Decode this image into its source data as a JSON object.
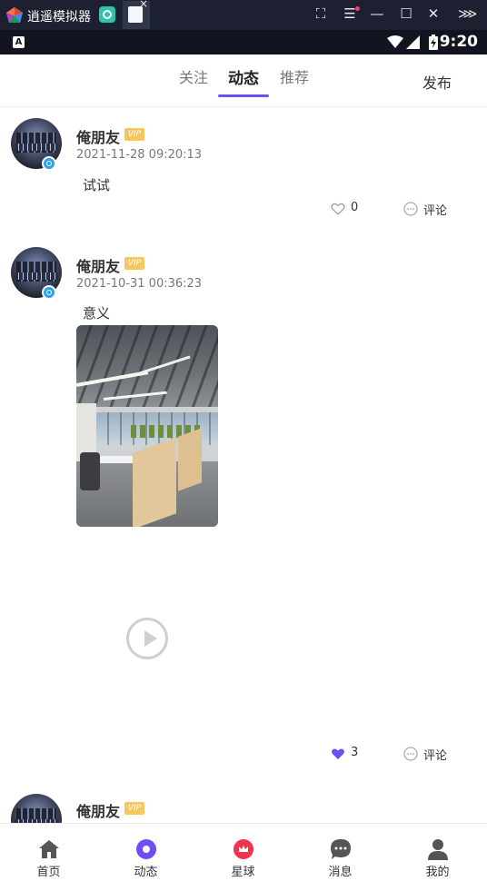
{
  "emulator": {
    "title": "逍遥模拟器",
    "controls": [
      "⛶",
      "☰",
      "—",
      "☐",
      "✕",
      "⋙"
    ]
  },
  "status_bar": {
    "time": "9:20",
    "icons": [
      "wifi-icon",
      "signal-icon",
      "battery-charging-icon"
    ]
  },
  "header": {
    "tabs": [
      {
        "label": "关注",
        "active": false
      },
      {
        "label": "动态",
        "active": true
      },
      {
        "label": "推荐",
        "active": false
      }
    ],
    "publish_label": "发布",
    "accent_color": "#6e4ef2"
  },
  "posts": [
    {
      "username": "俺朋友",
      "vip": "VIP",
      "timestamp": "2021-11-28 09:20:13",
      "content": "试试",
      "likes": "0",
      "liked": false,
      "comment_label": "评论"
    },
    {
      "username": "俺朋友",
      "vip": "VIP",
      "timestamp": "2021-10-31 00:36:23",
      "content": "意义",
      "has_image": true,
      "has_video": true,
      "likes": "3",
      "liked": true,
      "comment_label": "评论"
    },
    {
      "username": "俺朋友",
      "vip": "VIP"
    }
  ],
  "bottom_nav": [
    {
      "label": "首页",
      "icon": "home-icon",
      "active": false
    },
    {
      "label": "动态",
      "icon": "moments-icon",
      "active": true
    },
    {
      "label": "星球",
      "icon": "planet-icon",
      "active": false
    },
    {
      "label": "消息",
      "icon": "message-icon",
      "active": false
    },
    {
      "label": "我的",
      "icon": "profile-icon",
      "active": false
    }
  ]
}
